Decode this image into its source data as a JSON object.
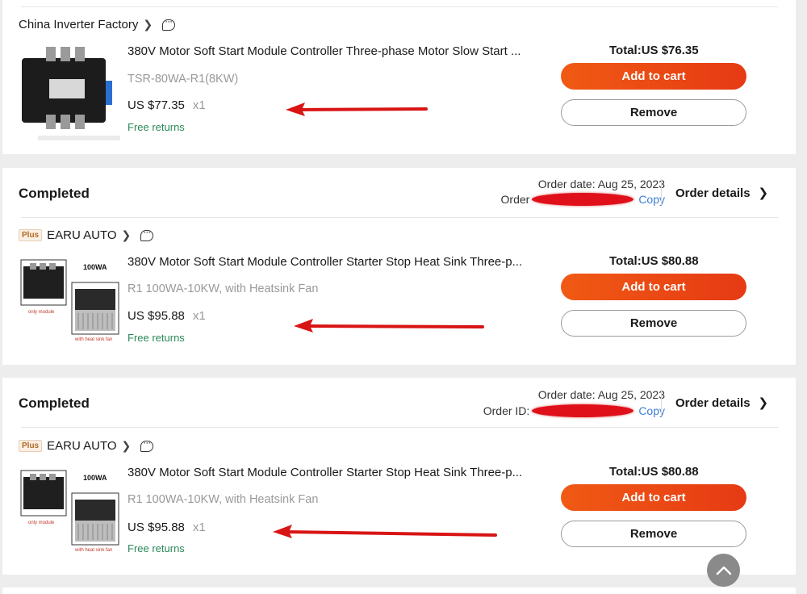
{
  "orders": [
    {
      "store": "China Inverter Factory",
      "title": "380V Motor Soft Start Module Controller Three-phase Motor Slow Start ...",
      "variant": "TSR-80WA-R1(8KW)",
      "price": "US $77.35",
      "qty": "x1",
      "returns": "Free returns",
      "total": "Total:US $76.35",
      "add_to_cart": "Add to cart",
      "remove": "Remove"
    },
    {
      "status": "Completed",
      "order_date": "Order date: Aug 25, 2023",
      "order_id_label": "Order",
      "copy": "Copy",
      "details": "Order details",
      "plus": "Plus",
      "store": "EARU AUTO",
      "title": "380V Motor Soft Start Module Controller Starter Stop Heat Sink Three-p...",
      "variant": "R1 100WA-10KW, with Heatsink Fan",
      "price": "US $95.88",
      "qty": "x1",
      "returns": "Free returns",
      "total": "Total:US $80.88",
      "add_to_cart": "Add to cart",
      "remove": "Remove",
      "thumb_label_top": "100WA",
      "thumb_label_left": "only module",
      "thumb_label_right": "with heat sink fan"
    },
    {
      "status": "Completed",
      "order_date": "Order date: Aug 25, 2023",
      "order_id_label": "Order ID:",
      "copy": "Copy",
      "details": "Order details",
      "plus": "Plus",
      "store": "EARU AUTO",
      "title": "380V Motor Soft Start Module Controller Starter Stop Heat Sink Three-p...",
      "variant": "R1 100WA-10KW, with Heatsink Fan",
      "price": "US $95.88",
      "qty": "x1",
      "returns": "Free returns",
      "total": "Total:US $80.88",
      "add_to_cart": "Add to cart",
      "remove": "Remove",
      "thumb_label_top": "100WA",
      "thumb_label_left": "only module",
      "thumb_label_right": "with heat sink fan"
    }
  ],
  "colors": {
    "accent": "#e8481a",
    "returns_green": "#2a8a58",
    "annotation_red": "#d81414",
    "redaction_red": "#e0101a"
  }
}
